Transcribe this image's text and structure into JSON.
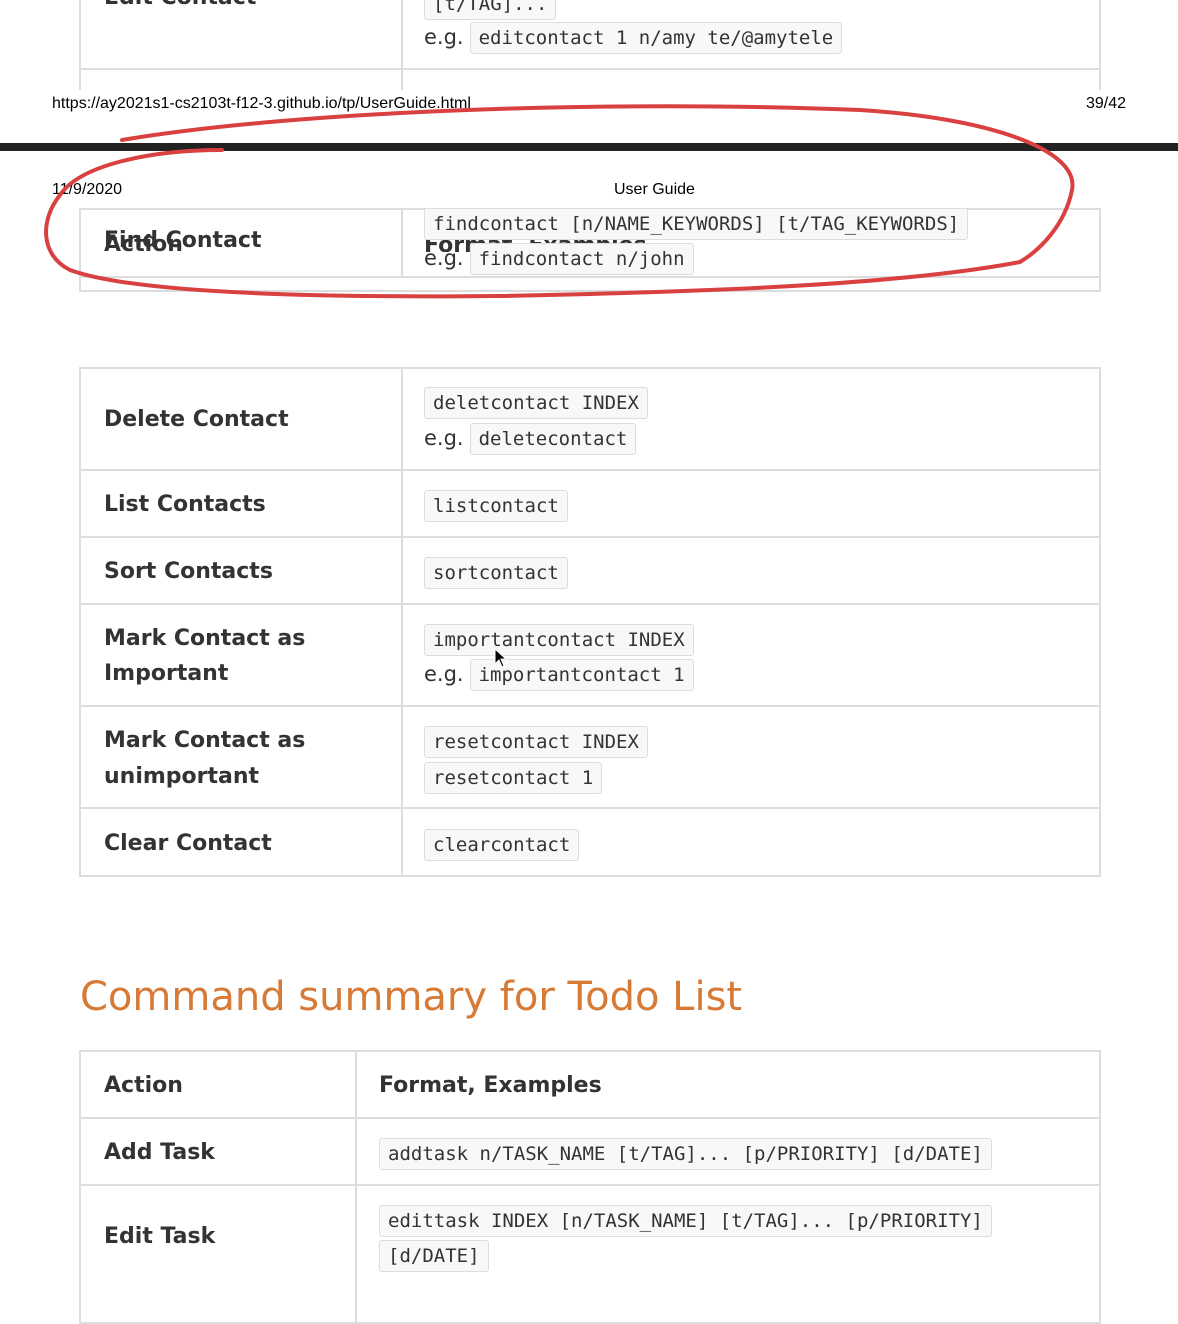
{
  "top_fragment": {
    "action": "Edit Contact",
    "format_tail": "[t/TAG]...",
    "example_prefix": "e.g.",
    "example": "editcontact 1 n/amy te/@amytele"
  },
  "page_footer": {
    "url": "https://ay2021s1-cs2103t-f12-3.github.io/tp/UserGuide.html",
    "page_number": "39/42"
  },
  "page_header": {
    "date": "11/9/2020",
    "title": "User Guide"
  },
  "overlap_row": {
    "header_action": "Action",
    "header_format": "Format, Examples",
    "action": "Find Contact",
    "format": "findcontact [n/NAME_KEYWORDS] [t/TAG_KEYWORDS]",
    "example_prefix": "e.g.",
    "example": "findcontact n/john"
  },
  "contact_rows": [
    {
      "action": "Delete Contact",
      "format": "deletcontact INDEX",
      "example_prefix": "e.g.",
      "example": "deletecontact"
    },
    {
      "action": "List Contacts",
      "format": "listcontact"
    },
    {
      "action": "Sort Contacts",
      "format": "sortcontact"
    },
    {
      "action_line1": "Mark Contact as",
      "action_line2": "Important",
      "format": "importantcontact INDEX",
      "example_prefix": "e.g.",
      "example": "importantcontact 1"
    },
    {
      "action_line1": "Mark Contact as",
      "action_line2": "unimportant",
      "format": "resetcontact INDEX",
      "example": "resetcontact 1"
    },
    {
      "action": "Clear Contact",
      "format": "clearcontact"
    }
  ],
  "todo_section": {
    "heading": "Command summary for Todo List",
    "header_action": "Action",
    "header_format": "Format, Examples",
    "rows": [
      {
        "action": "Add Task",
        "format": "addtask n/TASK_NAME [t/TAG]... [p/PRIORITY] [d/DATE]"
      },
      {
        "action": "Edit Task",
        "format_line1": "edittask INDEX [n/TASK_NAME] [t/TAG]... [p/PRIORITY]",
        "format_line2": "[d/DATE]"
      }
    ]
  },
  "annotation": {
    "color": "#d94040",
    "shape": "hand-drawn-ellipse"
  },
  "colors": {
    "heading": "#d67a36",
    "border": "#dddddd",
    "code_bg": "#f8f8f8",
    "page_break": "#222222"
  }
}
